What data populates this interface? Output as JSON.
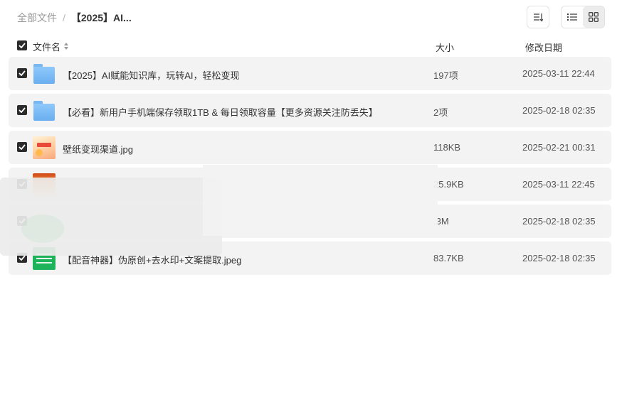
{
  "breadcrumb": {
    "root": "全部文件",
    "separator": "/",
    "current": "【2025】AI..."
  },
  "toolbar": {
    "sort_icon": "sort-list-icon",
    "list_view_icon": "list-view-icon",
    "grid_view_icon": "grid-view-icon",
    "active_view": "list"
  },
  "columns": {
    "name": "文件名",
    "size": "大小",
    "date": "修改日期"
  },
  "files": [
    {
      "name": "【2025】AI赋能知识库，玩转AI，轻松变现",
      "size": "197项",
      "date": "2025-03-11 22:44",
      "type": "folder"
    },
    {
      "name": "【必看】新用户手机端保存领取1TB & 每日领取容量【更多资源关注防丢失】",
      "size": "2项",
      "date": "2025-02-18 02:35",
      "type": "folder"
    },
    {
      "name": "壁纸变现渠道.jpg",
      "size": "118KB",
      "date": "2025-02-21 00:31",
      "type": "image"
    },
    {
      "name": "",
      "size": "25.9KB",
      "date": "2025-03-11 22:45",
      "type": "image"
    },
    {
      "name": "",
      "size": ".3M",
      "date": "2025-02-18 02:35",
      "type": "file"
    },
    {
      "name": "【配音神器】伪原创+去水印+文案提取.jpeg",
      "size": "83.7KB",
      "date": "2025-02-18 02:35",
      "type": "image"
    }
  ],
  "colors": {
    "row_bg": "#f3f3f3",
    "checkbox": "#2b2b2b",
    "folder": "#77b8f2"
  }
}
